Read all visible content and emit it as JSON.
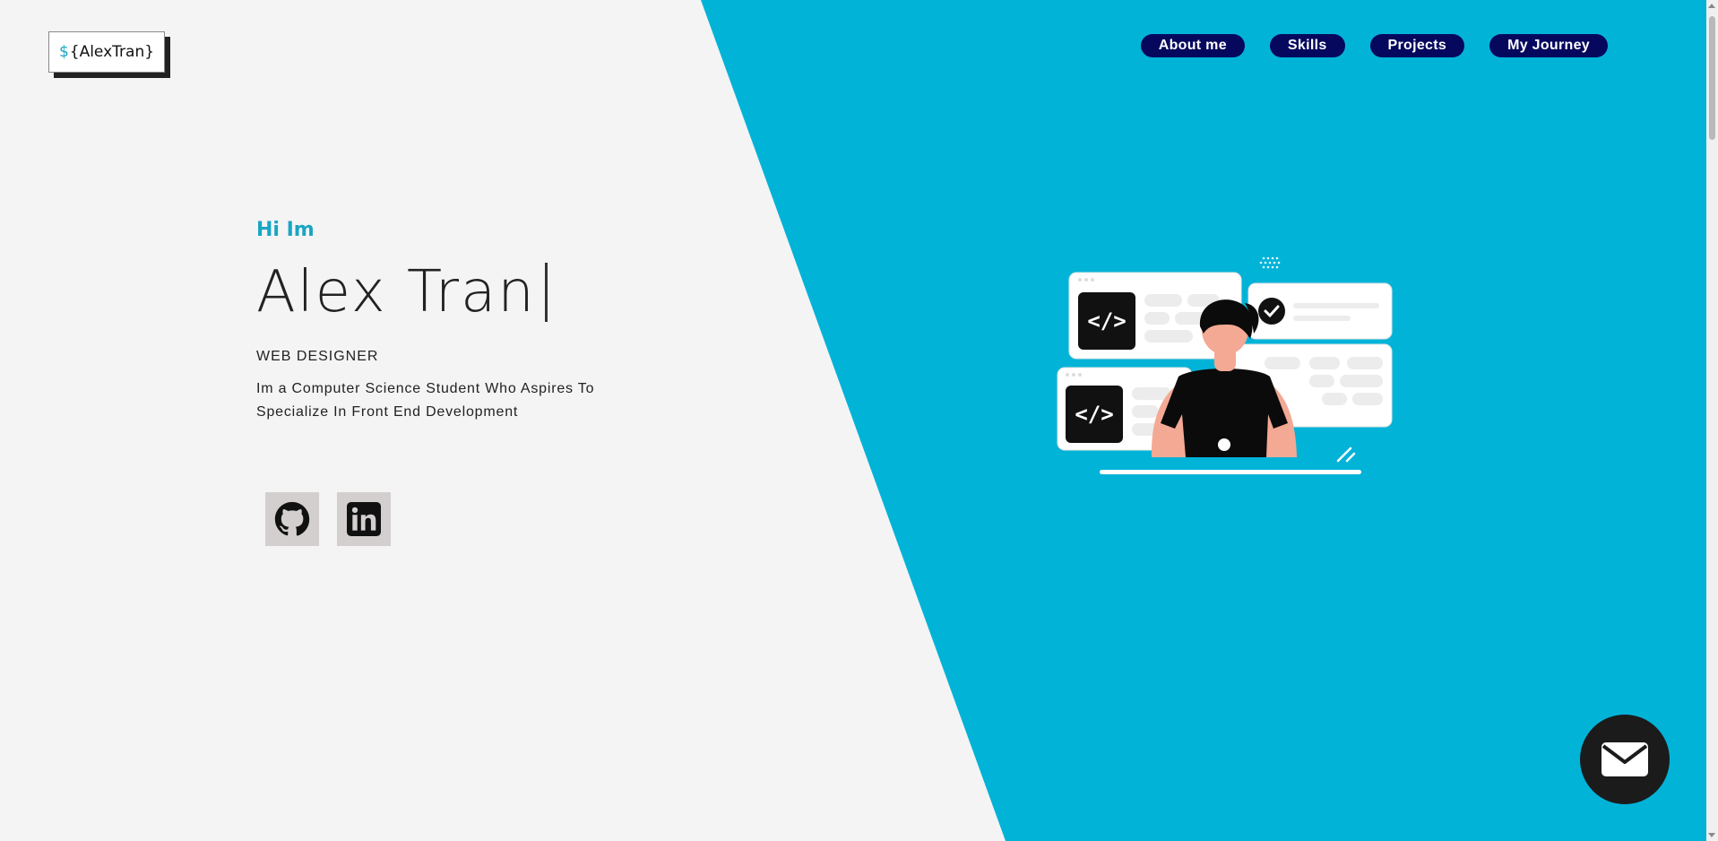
{
  "logo": {
    "dollar": "$",
    "text": "{AlexTran}"
  },
  "nav": [
    {
      "label": "About me"
    },
    {
      "label": "Skills"
    },
    {
      "label": "Projects"
    },
    {
      "label": "My Journey"
    }
  ],
  "hero": {
    "greeting": "Hi Im",
    "name": "Alex Tran",
    "role": "WEB DESIGNER",
    "description": "Im a Computer Science Student Who Aspires To Specialize In Front End Development"
  },
  "socials": [
    {
      "icon": "github-icon"
    },
    {
      "icon": "linkedin-icon"
    }
  ],
  "colors": {
    "accent": "#1aa5c3",
    "nav_bg": "#06085e",
    "left_bg": "#f4f4f5",
    "mail_bg": "#1b1b1b"
  }
}
